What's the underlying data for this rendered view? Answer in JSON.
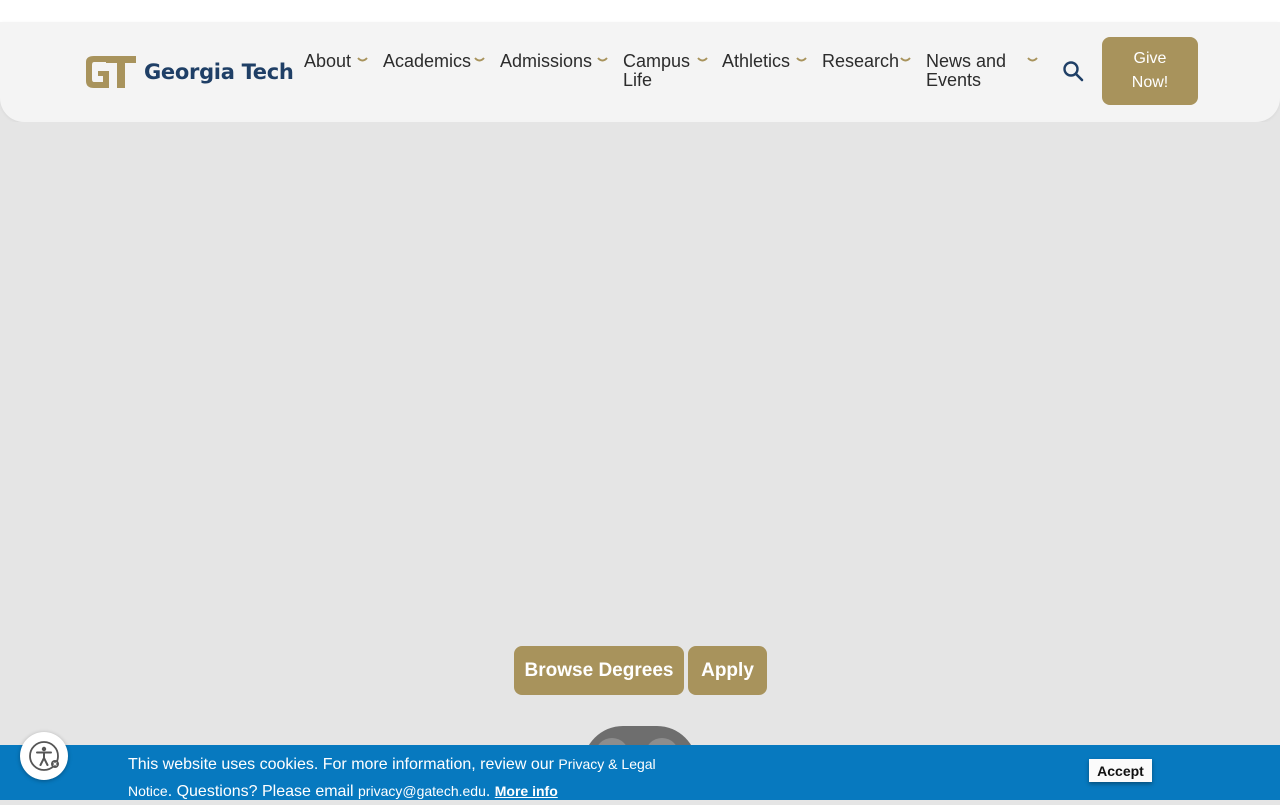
{
  "header": {
    "logo_text": "Georgia Tech",
    "logo_mark": "GT",
    "nav": [
      {
        "label_line1": "About",
        "label_line2": ""
      },
      {
        "label_line1": "Academics",
        "label_line2": ""
      },
      {
        "label_line1": "Admissions",
        "label_line2": ""
      },
      {
        "label_line1": "Campus",
        "label_line2": "Life"
      },
      {
        "label_line1": "Athletics",
        "label_line2": ""
      },
      {
        "label_line1": "Research",
        "label_line2": ""
      },
      {
        "label_line1": "News and",
        "label_line2": "Events"
      }
    ],
    "search_icon": "search-icon",
    "give_label": "Give Now!"
  },
  "hero": {
    "browse_label": "Browse Degrees",
    "apply_label": "Apply"
  },
  "cookie": {
    "text_1": "This website uses cookies. For more information, review our ",
    "privacy_link": "Privacy & Legal",
    "text_2": "Notice",
    "text_3": ". Questions? Please email ",
    "email": "privacy@gatech.edu",
    "text_4": ". ",
    "more_info": "More info",
    "accept_label": "Accept"
  },
  "colors": {
    "gold": "#a8935c",
    "navy": "#1f3f66",
    "cookie_blue": "#0779bf",
    "hero_bg": "#e5e5e5"
  }
}
